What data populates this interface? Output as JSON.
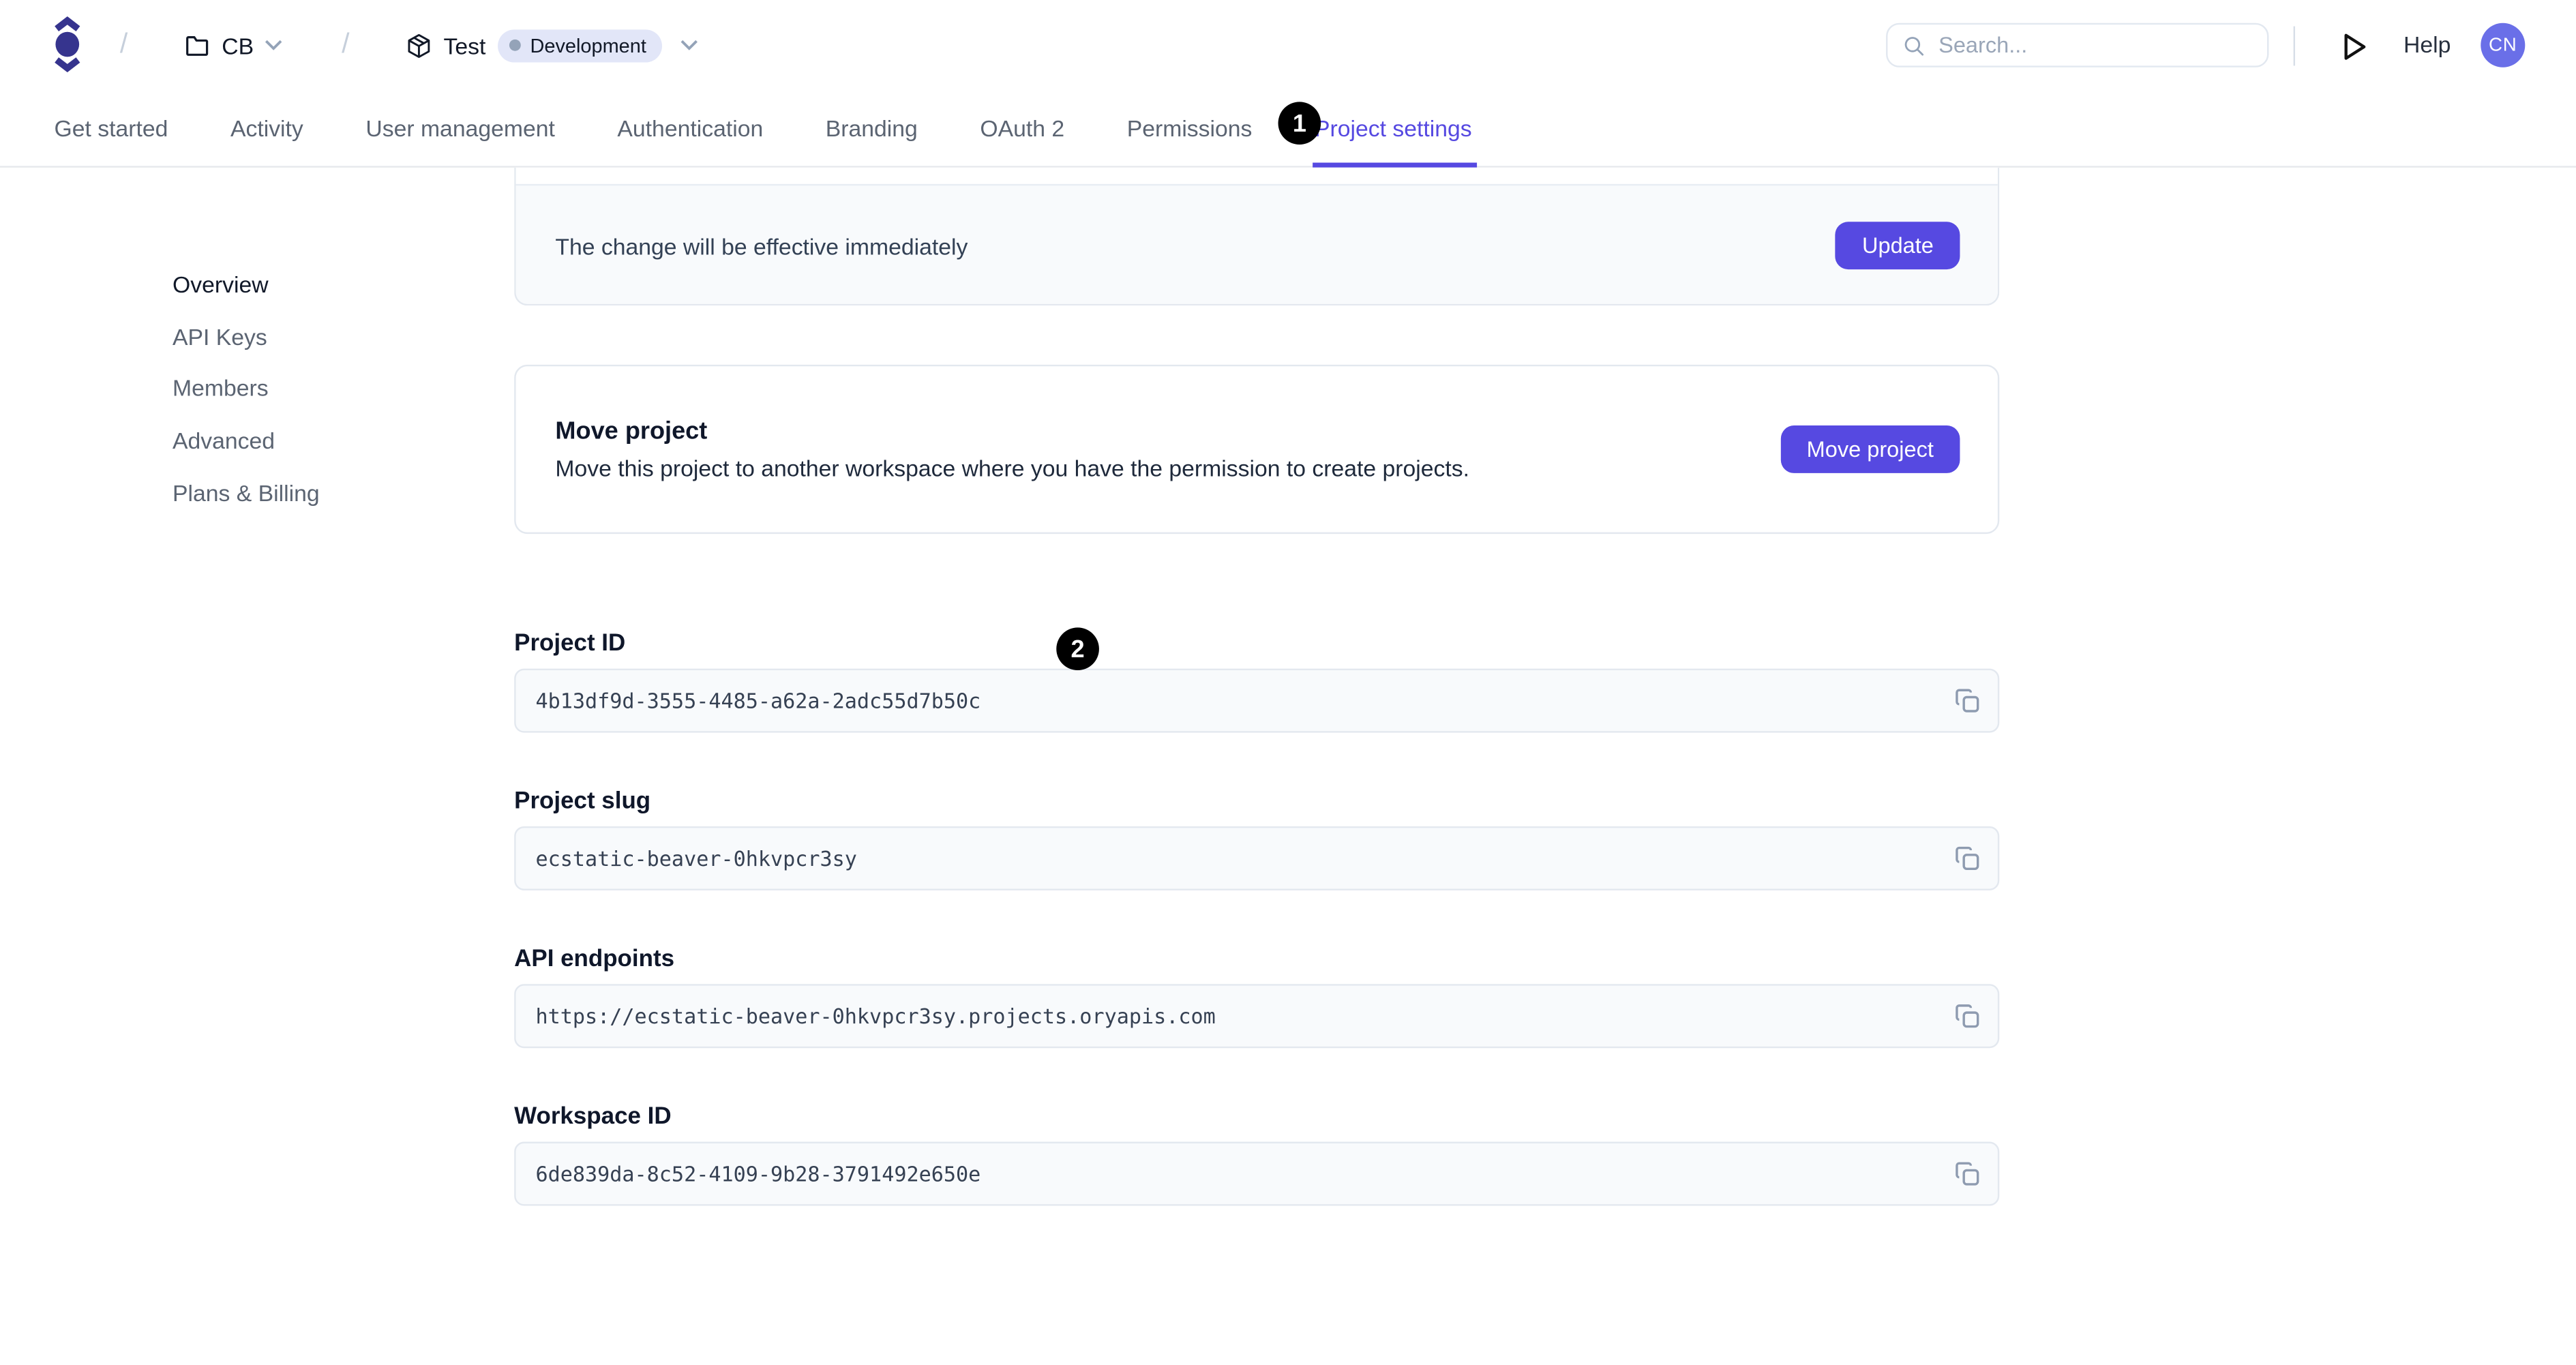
{
  "header": {
    "breadcrumb": {
      "separator": "/",
      "workspace_label": "CB",
      "project_label": "Test",
      "environment_badge": "Development"
    },
    "search": {
      "placeholder": "Search..."
    },
    "help_label": "Help",
    "avatar_initials": "CN"
  },
  "tabs": [
    {
      "label": "Get started",
      "active": false
    },
    {
      "label": "Activity",
      "active": false
    },
    {
      "label": "User management",
      "active": false
    },
    {
      "label": "Authentication",
      "active": false
    },
    {
      "label": "Branding",
      "active": false
    },
    {
      "label": "OAuth 2",
      "active": false
    },
    {
      "label": "Permissions",
      "active": false
    },
    {
      "label": "Project settings",
      "active": true
    }
  ],
  "annotations": {
    "badge1": "1",
    "badge2": "2"
  },
  "sidebar": {
    "items": [
      {
        "label": "Overview",
        "active": true
      },
      {
        "label": "API Keys",
        "active": false
      },
      {
        "label": "Members",
        "active": false
      },
      {
        "label": "Advanced",
        "active": false
      },
      {
        "label": "Plans & Billing",
        "active": false
      }
    ]
  },
  "update_notice": {
    "message": "The change will be effective immediately",
    "button_label": "Update"
  },
  "move_project": {
    "title": "Move project",
    "description": "Move this project to another workspace where you have the permission to create projects.",
    "button_label": "Move project"
  },
  "fields": [
    {
      "label": "Project ID",
      "value": "4b13df9d-3555-4485-a62a-2adc55d7b50c"
    },
    {
      "label": "Project slug",
      "value": "ecstatic-beaver-0hkvpcr3sy"
    },
    {
      "label": "API endpoints",
      "value": "https://ecstatic-beaver-0hkvpcr3sy.projects.oryapis.com"
    },
    {
      "label": "Workspace ID",
      "value": "6de839da-8c52-4109-9b28-3791492e650e"
    }
  ],
  "icons": {
    "logo": "ory-logo",
    "folder": "folder-icon",
    "package": "package-icon",
    "chevron": "chevron-down-icon",
    "search": "search-icon",
    "play": "play-icon",
    "copy": "copy-icon"
  },
  "colors": {
    "primary": "#5649e1",
    "logo": "#36348e",
    "avatar_bg": "#6a6fe8",
    "pill_bg": "#e2e6f8",
    "field_bg": "#f8fafc",
    "border": "#e3e8ef",
    "annotation_bg": "#000000"
  }
}
